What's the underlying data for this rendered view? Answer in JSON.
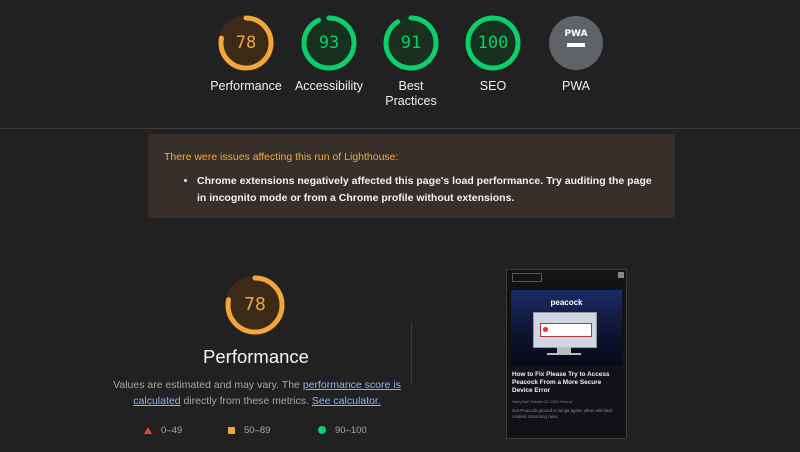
{
  "colors": {
    "average": "#f3a63b",
    "pass": "#0cce6b",
    "fail": "#ef4136",
    "pwa": "#5f6368"
  },
  "gauges": [
    {
      "score": "78",
      "label": "Performance",
      "value": 78,
      "rating": "average"
    },
    {
      "score": "93",
      "label": "Accessibility",
      "value": 93,
      "rating": "pass"
    },
    {
      "score": "91",
      "label": "Best Practices",
      "value": 91,
      "rating": "pass"
    },
    {
      "score": "100",
      "label": "SEO",
      "value": 100,
      "rating": "pass"
    },
    {
      "score": "",
      "label": "PWA",
      "badge": "PWA"
    }
  ],
  "warning": {
    "title": "There were issues affecting this run of Lighthouse:",
    "item": "Chrome extensions negatively affected this page's load performance. Try auditing the page in incognito mode or from a Chrome profile without extensions."
  },
  "performance": {
    "score": "78",
    "value": 78,
    "title": "Performance",
    "desc_text_1": "Values are estimated and may vary. The ",
    "desc_link_1": "performance score is calculated",
    "desc_text_2": " directly from these metrics. ",
    "desc_link_2": "See calculator."
  },
  "legend": {
    "fail": "0–49",
    "average": "50–89",
    "pass": "90–100"
  },
  "screenshot": {
    "brand": "peacock",
    "title": "How to Fix Please Try to Access Peacock From a More Secure Device Error",
    "meta": "Harry Ball    October 22, 2022    How to",
    "excerpt": "Got Peacock ground to wings again, what unlimited content streaming rains"
  }
}
